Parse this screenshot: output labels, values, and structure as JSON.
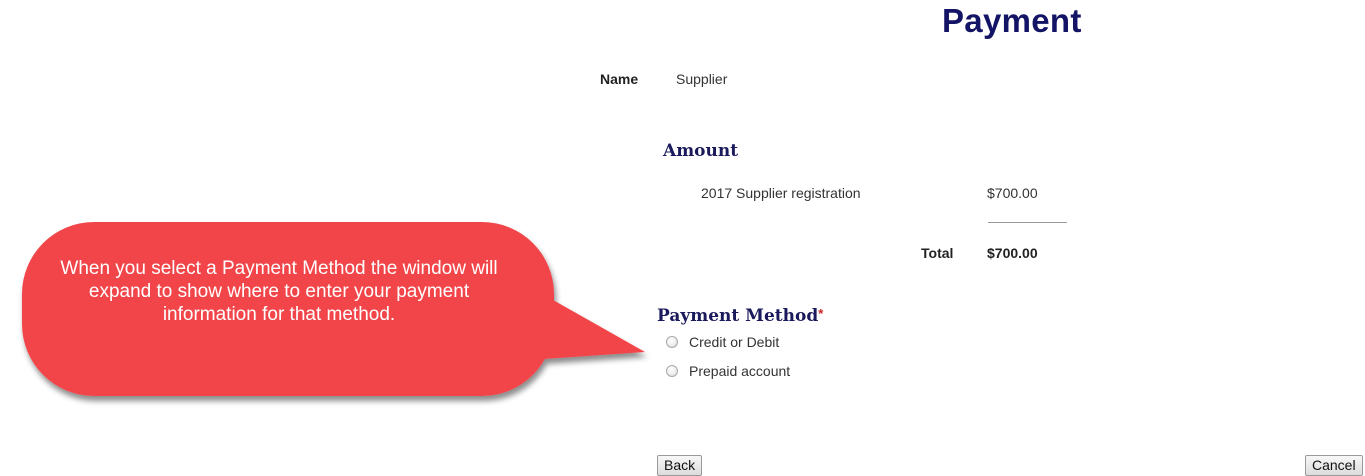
{
  "page": {
    "title": "Payment"
  },
  "customer": {
    "name_label": "Name",
    "name_value": "Supplier"
  },
  "amount": {
    "heading": "Amount",
    "line_items": [
      {
        "description": "2017 Supplier registration",
        "amount": "$700.00"
      }
    ],
    "total_label": "Total",
    "total_value": "$700.00"
  },
  "payment_method": {
    "heading": "Payment Method",
    "required_marker": "*",
    "options": [
      {
        "label": "Credit or Debit",
        "selected": false
      },
      {
        "label": "Prepaid account",
        "selected": false
      }
    ]
  },
  "callout": {
    "text": "When you select a Payment Method the window will expand to show where to enter your payment information for that method.",
    "color": "#f2454a"
  },
  "buttons": {
    "back_label": "Back",
    "cancel_label": "Cancel"
  },
  "colors": {
    "title": "#141466",
    "heading": "#1a1a5c",
    "required": "#cc2222"
  }
}
